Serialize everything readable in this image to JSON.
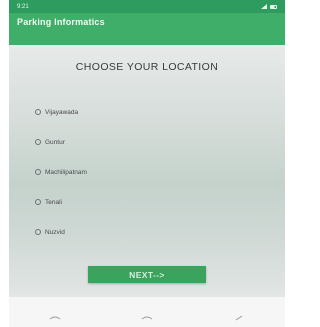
{
  "status_bar": {
    "time": "9:21",
    "right_icons": [
      "signal-icon",
      "battery-icon"
    ]
  },
  "app_bar": {
    "title": "Parking Informatics"
  },
  "main": {
    "heading": "CHOOSE YOUR LOCATION",
    "locations": [
      {
        "label": "Vijayawada",
        "selected": false
      },
      {
        "label": "Guntur",
        "selected": false
      },
      {
        "label": "Machilipatnam",
        "selected": false
      },
      {
        "label": "Tenali",
        "selected": false
      },
      {
        "label": "Nuzvid",
        "selected": false
      }
    ],
    "next_label": "NEXT-->"
  },
  "nav_bar": {
    "buttons": [
      "back-icon",
      "home-icon",
      "recents-icon"
    ]
  },
  "colors": {
    "status_bar": "#2e9c5e",
    "app_bar": "#3fae69",
    "button": "#3aa35e"
  }
}
